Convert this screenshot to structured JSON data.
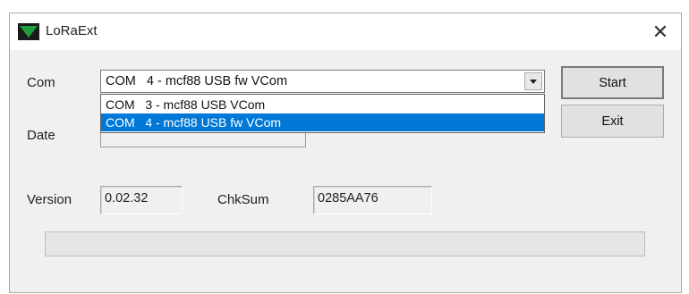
{
  "window": {
    "title": "LoRaExt",
    "close_label": "✕",
    "icon": "green-triangle-app-icon"
  },
  "form": {
    "com_label": "Com",
    "date_label": "Date",
    "version_label": "Version",
    "chksum_label": "ChkSum",
    "com_selected": "COM   4 - mcf88 USB fw VCom",
    "com_options": [
      "COM   3 - mcf88 USB VCom",
      "COM   4 - mcf88 USB fw VCom"
    ],
    "version_value": "0.02.32",
    "chksum_value": "0285AA76"
  },
  "buttons": {
    "start_label": "Start",
    "exit_label": "Exit"
  },
  "progress": {
    "fraction": 0
  },
  "colors": {
    "selection": "#0078d7",
    "icon_green": "#1f9e3a"
  }
}
